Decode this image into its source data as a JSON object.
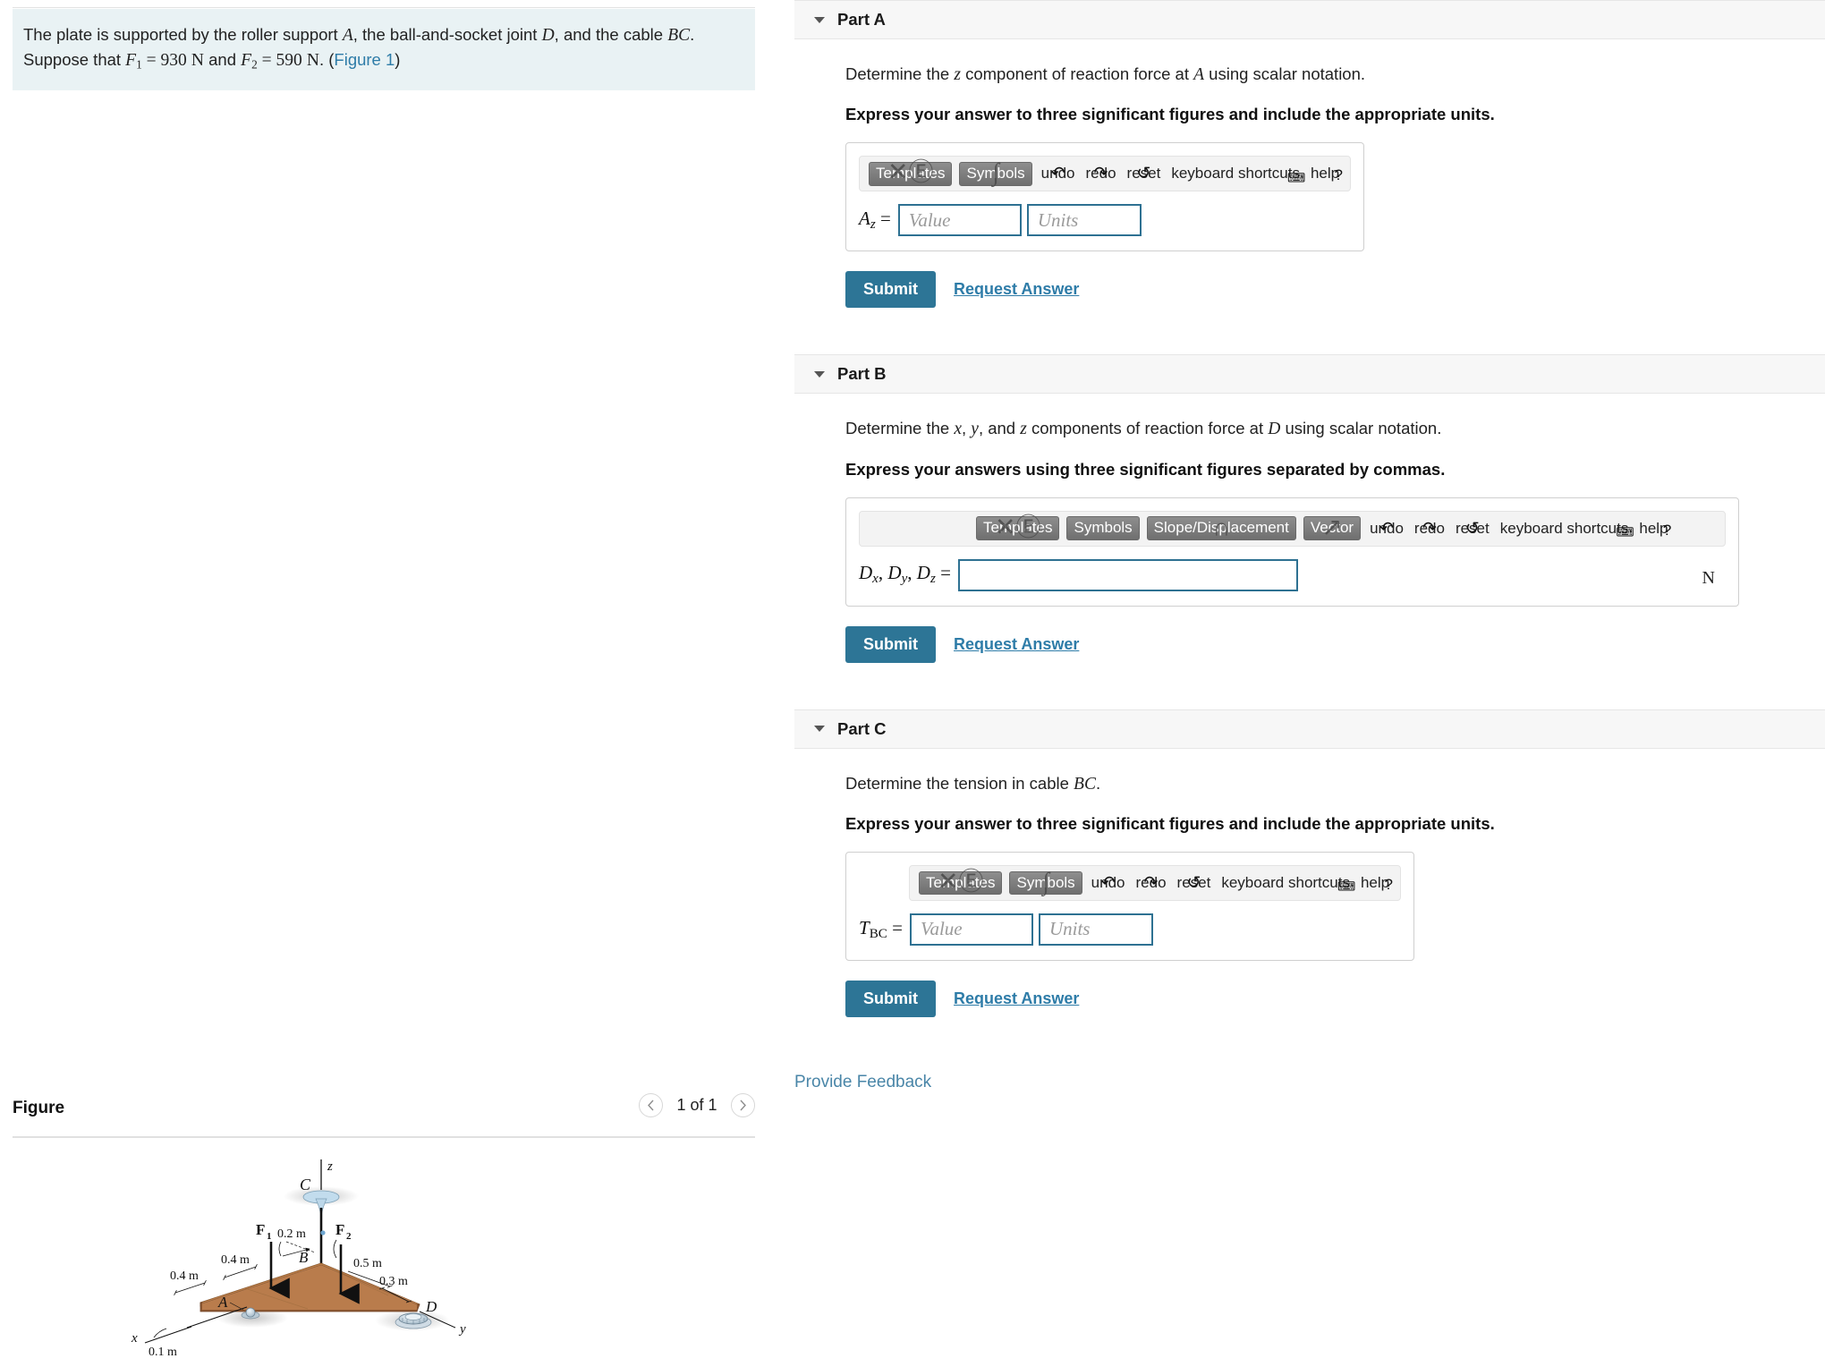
{
  "problem": {
    "line1_a": "The plate is supported by the roller support ",
    "sym_A": "A",
    "line1_b": ", the ball-and-socket joint ",
    "sym_D": "D",
    "line1_c": ", and the cable ",
    "sym_BC": "BC",
    "line1_d": ".",
    "line2_a": "Suppose that ",
    "F1_sym": "F",
    "F1_sub": "1",
    "eq1": " = 930",
    "unit1": "N",
    "and": " and ",
    "F2_sym": "F",
    "F2_sub": "2",
    "eq2": " = 590",
    "unit2": "N",
    "period": ". (",
    "figure_link": "Figure 1",
    "close_paren": ")"
  },
  "figure": {
    "heading": "Figure",
    "pager_label": "1 of 1",
    "prev_icon": "chevron-left",
    "next_icon": "chevron-right",
    "labels": {
      "axis_z": "z",
      "axis_x": "x",
      "axis_y": "y",
      "point_A": "A",
      "point_B": "B",
      "point_C": "C",
      "point_D": "D",
      "force_F1": "F",
      "force_F1_sub": "1",
      "force_F2": "F",
      "force_F2_sub": "2",
      "dim_0_2": "0.2 m",
      "dim_0_4a": "0.4 m",
      "dim_0_4b": "0.4 m",
      "dim_0_5": "0.5 m",
      "dim_0_3": "0.3 m",
      "dim_0_1": "0.1 m"
    },
    "colors": {
      "plate_top": "#c08254",
      "plate_edge": "#8b5a33",
      "plate_side": "#a06c42",
      "support_blue": "#b8cfe0"
    }
  },
  "toolbar": {
    "templates": "Templates",
    "symbols": "Symbols",
    "slope_displacement": "Slope/Displacement",
    "vector": "Vector",
    "undo": "undo",
    "redo": "redo",
    "reset": "reset",
    "keyboard_shortcuts": "keyboard shortcuts",
    "help": "help",
    "ghost_templates": "✕Ⓔ",
    "ghost_symbols": "∫",
    "ghost_slope": "∩",
    "ghost_vector": "↗",
    "icon_undo": "↶",
    "icon_redo": "↷",
    "icon_reset": "↺",
    "icon_keyboard": "⌨",
    "icon_help": "?"
  },
  "parts": [
    {
      "id": "part-a",
      "title": "Part A",
      "question_a": "Determine the ",
      "question_var": "z",
      "question_b": " component of reaction force at ",
      "question_point": "A",
      "question_c": " using scalar notation.",
      "instruction": "Express your answer to three significant figures and include the appropriate units.",
      "label_main": "A",
      "label_sub": "z",
      "label_eq": "=",
      "value_placeholder": "Value",
      "units_placeholder": "Units",
      "value": "",
      "units": "",
      "submit": "Submit",
      "request": "Request Answer",
      "toolbar_buttons": [
        "Templates",
        "Symbols"
      ]
    },
    {
      "id": "part-b",
      "title": "Part B",
      "question_a": "Determine the ",
      "question_var": "x",
      "question_var2": "y",
      "question_var3": "z",
      "question_b": " components of reaction force at ",
      "question_point": "D",
      "question_c": " using scalar notation.",
      "instruction": "Express your answers using three significant figures separated by commas.",
      "label_main": "D",
      "label_sub": "x",
      "label_main2": "D",
      "label_sub2": "y",
      "label_main3": "D",
      "label_sub3": "z",
      "label_eq": "=",
      "value": "",
      "unit_suffix": "N",
      "submit": "Submit",
      "request": "Request Answer",
      "toolbar_buttons": [
        "Templates",
        "Symbols",
        "Slope/Displacement",
        "Vector"
      ]
    },
    {
      "id": "part-c",
      "title": "Part C",
      "question_a": "Determine the tension in cable ",
      "question_point": "BC",
      "question_c": ".",
      "instruction": "Express your answer to three significant figures and include the appropriate units.",
      "label_main": "T",
      "label_sub": "BC",
      "label_eq": "=",
      "value_placeholder": "Value",
      "units_placeholder": "Units",
      "value": "",
      "units": "",
      "submit": "Submit",
      "request": "Request Answer",
      "toolbar_buttons": [
        "Templates",
        "Symbols"
      ]
    }
  ],
  "footer": {
    "provide_feedback": "Provide Feedback"
  },
  "colors": {
    "accent": "#2d7596",
    "link": "#2e7ca8",
    "statement_bg": "#e9f2f4",
    "part_header_bg": "#f7f7f7",
    "divider": "#c5d3dc",
    "input_border": "#2e7192"
  }
}
